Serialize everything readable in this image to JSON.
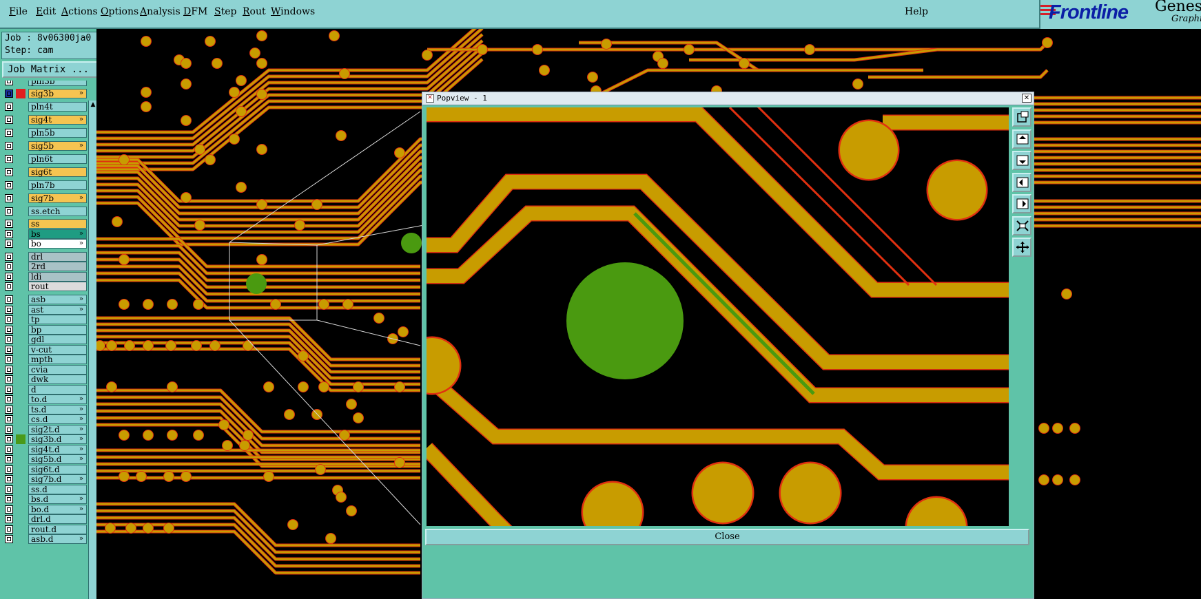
{
  "menu": {
    "items": [
      {
        "label": "File",
        "u": "F",
        "rest": "ile"
      },
      {
        "label": "Edit",
        "u": "E",
        "rest": "dit"
      },
      {
        "label": "Actions",
        "u": "A",
        "rest": "ctions"
      },
      {
        "label": "Options",
        "u": "O",
        "rest": "ptions"
      },
      {
        "label": "Analysis",
        "u": "A",
        "rest": "nalysis"
      },
      {
        "label": "DFM",
        "u": "D",
        "rest": "FM"
      },
      {
        "label": "Step",
        "u": "S",
        "rest": "tep"
      },
      {
        "label": "Rout",
        "u": "R",
        "rest": "out"
      },
      {
        "label": "Windows",
        "u": "W",
        "rest": "indows"
      }
    ],
    "help": "Help"
  },
  "brand": {
    "logo": "Frontline",
    "product": "Genes",
    "sub": "Graphi"
  },
  "job": {
    "job_line": "Job : 8v06300ja0",
    "step_line": "Step: cam",
    "matrix_button": "Job Matrix ..."
  },
  "layers": [
    {
      "name": "pln3b",
      "color": "#8ed3d3",
      "flag": ""
    },
    {
      "name": "sig3b",
      "color": "#f5c451",
      "flag": "»",
      "mark": "#e02020",
      "selected": true
    },
    {
      "name": "pln4t",
      "color": "#8ed3d3",
      "flag": ""
    },
    {
      "name": "sig4t",
      "color": "#f5c451",
      "flag": "»"
    },
    {
      "name": "pln5b",
      "color": "#8ed3d3",
      "flag": ""
    },
    {
      "name": "sig5b",
      "color": "#f5c451",
      "flag": "»"
    },
    {
      "name": "pln6t",
      "color": "#8ed3d3",
      "flag": ""
    },
    {
      "name": "sig6t",
      "color": "#f5c451",
      "flag": ""
    },
    {
      "name": "pln7b",
      "color": "#8ed3d3",
      "flag": ""
    },
    {
      "name": "sig7b",
      "color": "#f5c451",
      "flag": "»"
    },
    {
      "name": "ss.etch",
      "color": "#8ed3d3",
      "flag": ""
    },
    {
      "name": "ss",
      "color": "#f5c451",
      "flag": ""
    },
    {
      "name": "bs",
      "color": "#1f9c82",
      "flag": "»"
    },
    {
      "name": "bo",
      "color": "#ffffff",
      "flag": "»"
    },
    {
      "name": "drl",
      "color": "#a9c2c6",
      "flag": ""
    },
    {
      "name": "2rd",
      "color": "#a9c2c6",
      "flag": ""
    },
    {
      "name": "ldi",
      "color": "#a9c2c6",
      "flag": ""
    },
    {
      "name": "rout",
      "color": "#dcdcdc",
      "flag": ""
    },
    {
      "name": "asb",
      "color": "#8ed3d3",
      "flag": "»"
    },
    {
      "name": "ast",
      "color": "#8ed3d3",
      "flag": "»"
    },
    {
      "name": "tp",
      "color": "#8ed3d3",
      "flag": ""
    },
    {
      "name": "bp",
      "color": "#8ed3d3",
      "flag": ""
    },
    {
      "name": "gdl",
      "color": "#8ed3d3",
      "flag": ""
    },
    {
      "name": "v-cut",
      "color": "#8ed3d3",
      "flag": ""
    },
    {
      "name": "mpth",
      "color": "#8ed3d3",
      "flag": ""
    },
    {
      "name": "cvia",
      "color": "#8ed3d3",
      "flag": ""
    },
    {
      "name": "dwk",
      "color": "#8ed3d3",
      "flag": ""
    },
    {
      "name": "d",
      "color": "#8ed3d3",
      "flag": ""
    },
    {
      "name": "to.d",
      "color": "#8ed3d3",
      "flag": "»"
    },
    {
      "name": "ts.d",
      "color": "#8ed3d3",
      "flag": "»"
    },
    {
      "name": "cs.d",
      "color": "#8ed3d3",
      "flag": "»"
    },
    {
      "name": "sig2t.d",
      "color": "#8ed3d3",
      "flag": "»"
    },
    {
      "name": "sig3b.d",
      "color": "#8ed3d3",
      "flag": "»",
      "mark": "#4a9a1a"
    },
    {
      "name": "sig4t.d",
      "color": "#8ed3d3",
      "flag": "»"
    },
    {
      "name": "sig5b.d",
      "color": "#8ed3d3",
      "flag": "»"
    },
    {
      "name": "sig6t.d",
      "color": "#8ed3d3",
      "flag": ""
    },
    {
      "name": "sig7b.d",
      "color": "#8ed3d3",
      "flag": "»"
    },
    {
      "name": "ss.d",
      "color": "#8ed3d3",
      "flag": ""
    },
    {
      "name": "bs.d",
      "color": "#8ed3d3",
      "flag": "»"
    },
    {
      "name": "bo.d",
      "color": "#8ed3d3",
      "flag": "»"
    },
    {
      "name": "drl.d",
      "color": "#8ed3d3",
      "flag": ""
    },
    {
      "name": "rout.d",
      "color": "#8ed3d3",
      "flag": ""
    },
    {
      "name": "asb.d",
      "color": "#8ed3d3",
      "flag": "»"
    }
  ],
  "popview": {
    "title": "Popview - 1",
    "close_label": "Close",
    "close_x": "✕"
  },
  "colors": {
    "trace": "#c89c00",
    "trace_outline": "#e03010",
    "highlight": "#4a9a10",
    "panel": "#8ed3d3"
  },
  "icons": [
    "zoom-home-icon",
    "pan-up-icon",
    "pan-down-icon",
    "pan-left-icon",
    "pan-right-icon",
    "zoom-fit-icon",
    "zoom-center-icon"
  ]
}
